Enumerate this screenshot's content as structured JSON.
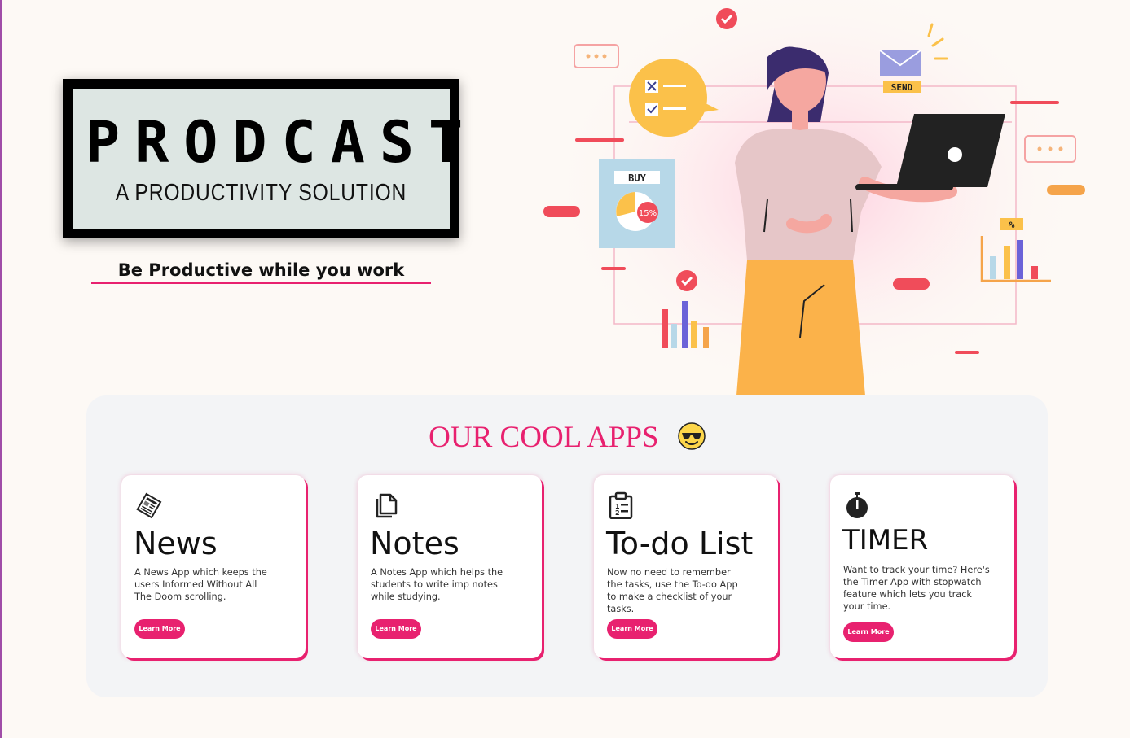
{
  "brand": {
    "title": "PRODCAST",
    "subtitle": "A PRODUCTIVITY SOLUTION",
    "tagline": "Be Productive while you work"
  },
  "hero_illustration": {
    "buy_label": "BUY",
    "discount_label": "15%",
    "send_label": "SEND",
    "percent_label": "%"
  },
  "apps": {
    "heading": "OUR COOL APPS",
    "heading_icon": "sunglasses-emoji-icon",
    "accent_color": "#e8216f",
    "cards": [
      {
        "name": "News",
        "icon": "newspaper-icon",
        "description": "A News App which keeps the users Informed Without All The Doom scrolling.",
        "button": "Learn More"
      },
      {
        "name": "Notes",
        "icon": "documents-icon",
        "description": "A Notes App which helps the students to write imp notes while studying.",
        "button": "Learn More"
      },
      {
        "name": "To-do List",
        "icon": "clipboard-list-icon",
        "description": "Now no need to remember the tasks, use the To-do App to make a checklist of your tasks.",
        "button": "Learn More"
      },
      {
        "name": "TIMER",
        "icon": "stopwatch-icon",
        "description": "Want to track your time? Here's the Timer App with stopwatch feature which lets you track your time.",
        "button": "Learn More"
      }
    ]
  }
}
